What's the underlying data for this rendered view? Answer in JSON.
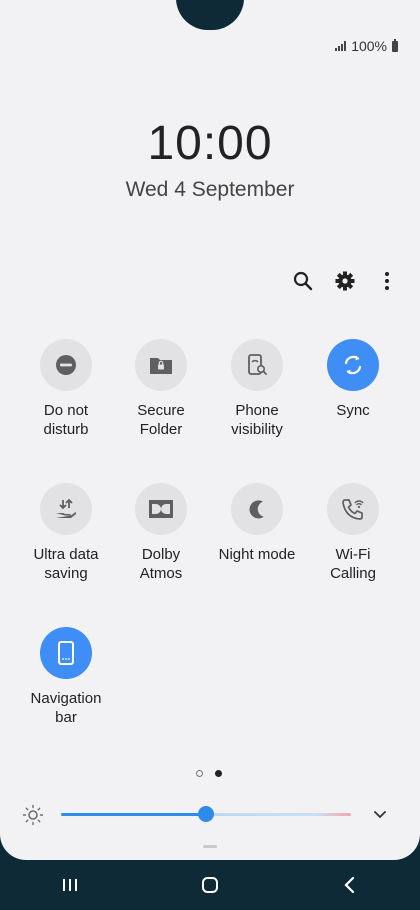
{
  "status_bar": {
    "battery_text": "100%"
  },
  "lock": {
    "time": "10:00",
    "date": "Wed 4 September"
  },
  "toolbar": {
    "icons": [
      "search-icon",
      "gear-icon",
      "more-vertical-icon"
    ]
  },
  "tiles": [
    {
      "label": "Do not\ndisturb",
      "icon": "minus-circle-icon",
      "active": false
    },
    {
      "label": "Secure\nFolder",
      "icon": "folder-lock-icon",
      "active": false
    },
    {
      "label": "Phone\nvisibility",
      "icon": "phone-search-icon",
      "active": false
    },
    {
      "label": "Sync",
      "icon": "sync-icon",
      "active": true
    },
    {
      "label": "Ultra data\nsaving",
      "icon": "data-saving-icon",
      "active": false
    },
    {
      "label": "Dolby\nAtmos",
      "icon": "dolby-icon",
      "active": false
    },
    {
      "label": "Night mode",
      "icon": "moon-icon",
      "active": false
    },
    {
      "label": "Wi-Fi\nCalling",
      "icon": "wifi-calling-icon",
      "active": false
    },
    {
      "label": "Navigation\nbar",
      "icon": "phone-navigation-icon",
      "active": true
    }
  ],
  "page_indicator": {
    "current_page": 2,
    "total_pages": 2
  },
  "brightness": {
    "level": 0.5
  },
  "colors": {
    "accent": "#3e8ef5",
    "panel": "#f2f2f4",
    "navbar": "#0d2a36"
  }
}
